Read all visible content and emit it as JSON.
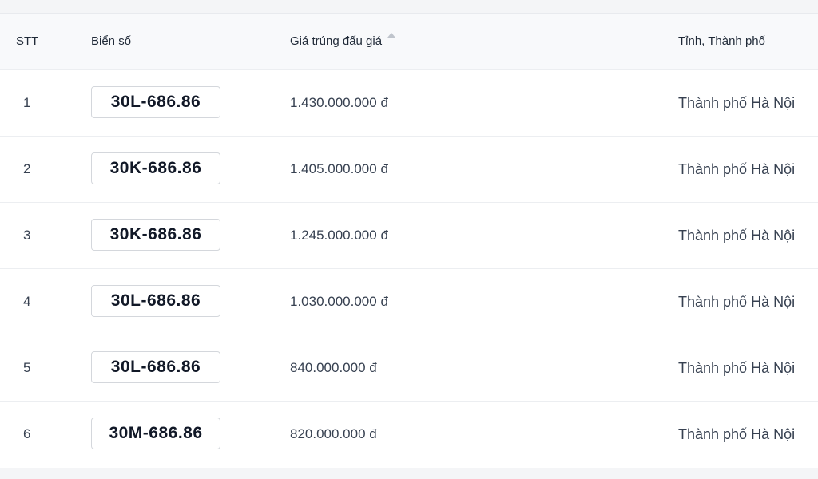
{
  "table": {
    "headers": {
      "stt": "STT",
      "plate": "Biển số",
      "price": "Giá trúng đấu giá",
      "province": "Tỉnh, Thành phố"
    },
    "sort_icon": "sort-ascending-icon",
    "rows": [
      {
        "stt": "1",
        "plate": "30L-686.86",
        "price": "1.430.000.000 đ",
        "province": "Thành phố Hà Nội"
      },
      {
        "stt": "2",
        "plate": "30K-686.86",
        "price": "1.405.000.000 đ",
        "province": "Thành phố Hà Nội"
      },
      {
        "stt": "3",
        "plate": "30K-686.86",
        "price": "1.245.000.000 đ",
        "province": "Thành phố Hà Nội"
      },
      {
        "stt": "4",
        "plate": "30L-686.86",
        "price": "1.030.000.000 đ",
        "province": "Thành phố Hà Nội"
      },
      {
        "stt": "5",
        "plate": "30L-686.86",
        "price": "840.000.000 đ",
        "province": "Thành phố Hà Nội"
      },
      {
        "stt": "6",
        "plate": "30M-686.86",
        "price": "820.000.000 đ",
        "province": "Thành phố Hà Nội"
      }
    ]
  }
}
